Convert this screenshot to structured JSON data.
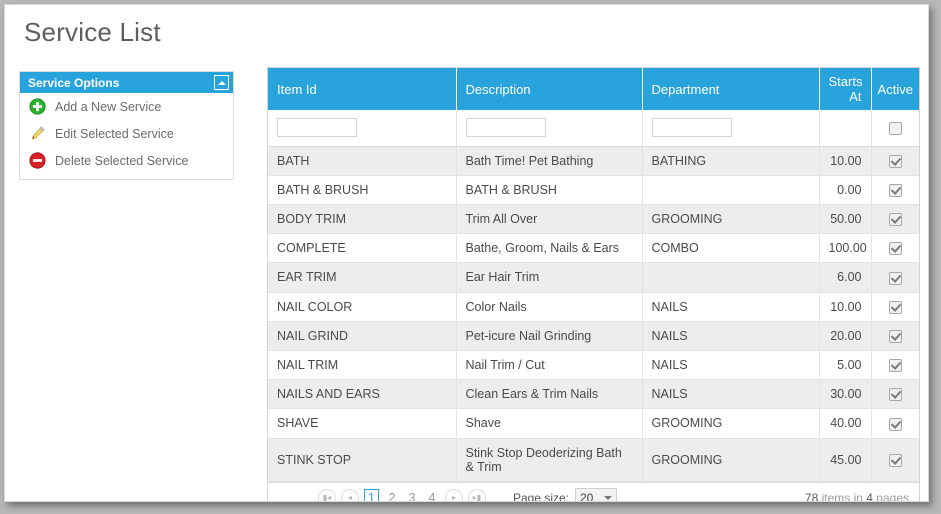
{
  "page": {
    "title": "Service List"
  },
  "options_panel": {
    "header": "Service Options",
    "collapse_icon": "chevron-up-icon",
    "items": [
      {
        "label": "Add a New Service",
        "icon": "add-circle-icon",
        "color": "#2ab02a"
      },
      {
        "label": "Edit Selected Service",
        "icon": "pencil-icon",
        "color": "#e8c437"
      },
      {
        "label": "Delete Selected Service",
        "icon": "delete-circle-icon",
        "color": "#d9202a"
      }
    ]
  },
  "grid": {
    "columns": [
      {
        "key": "item_id",
        "label": "Item Id",
        "align": "left"
      },
      {
        "key": "description",
        "label": "Description",
        "align": "left"
      },
      {
        "key": "department",
        "label": "Department",
        "align": "left"
      },
      {
        "key": "starts_at",
        "label": "Starts At",
        "align": "right"
      },
      {
        "key": "active",
        "label": "Active",
        "align": "center"
      }
    ],
    "filters": {
      "item_id": "",
      "description": "",
      "department": "",
      "active_checked": false
    },
    "rows": [
      {
        "item_id": "BATH",
        "description": "Bath Time! Pet Bathing",
        "department": "BATHING",
        "starts_at": "10.00",
        "active": true
      },
      {
        "item_id": "BATH & BRUSH",
        "description": "BATH & BRUSH",
        "department": "",
        "starts_at": "0.00",
        "active": true
      },
      {
        "item_id": "BODY TRIM",
        "description": "Trim All Over",
        "department": "GROOMING",
        "starts_at": "50.00",
        "active": true
      },
      {
        "item_id": "COMPLETE",
        "description": "Bathe, Groom, Nails & Ears",
        "department": "COMBO",
        "starts_at": "100.00",
        "active": true
      },
      {
        "item_id": "EAR TRIM",
        "description": "Ear Hair Trim",
        "department": "",
        "starts_at": "6.00",
        "active": true
      },
      {
        "item_id": "NAIL COLOR",
        "description": "Color Nails",
        "department": "NAILS",
        "starts_at": "10.00",
        "active": true
      },
      {
        "item_id": "NAIL GRIND",
        "description": "Pet-icure Nail Grinding",
        "department": "NAILS",
        "starts_at": "20.00",
        "active": true
      },
      {
        "item_id": "NAIL TRIM",
        "description": "Nail Trim / Cut",
        "department": "NAILS",
        "starts_at": "5.00",
        "active": true
      },
      {
        "item_id": "NAILS AND EARS",
        "description": "Clean Ears & Trim Nails",
        "department": "NAILS",
        "starts_at": "30.00",
        "active": true
      },
      {
        "item_id": "SHAVE",
        "description": "Shave",
        "department": "GROOMING",
        "starts_at": "40.00",
        "active": true
      },
      {
        "item_id": "STINK STOP",
        "description": "Stink Stop Deoderizing Bath & Trim",
        "department": "GROOMING",
        "starts_at": "45.00",
        "active": true
      }
    ]
  },
  "pager": {
    "first_icon": "first-page-icon",
    "prev_icon": "previous-page-icon",
    "next_icon": "next-page-icon",
    "last_icon": "last-page-icon",
    "pages": [
      "1",
      "2",
      "3",
      "4"
    ],
    "current_page": "1",
    "page_size_label": "Page size:",
    "page_size_value": "20",
    "info_count": "78",
    "info_mid": " items in ",
    "info_pages": "4",
    "info_suffix": " pages"
  },
  "theme": {
    "accent": "#29a3dc",
    "row_alt": "#ededed",
    "text": "#4a4a4a"
  }
}
